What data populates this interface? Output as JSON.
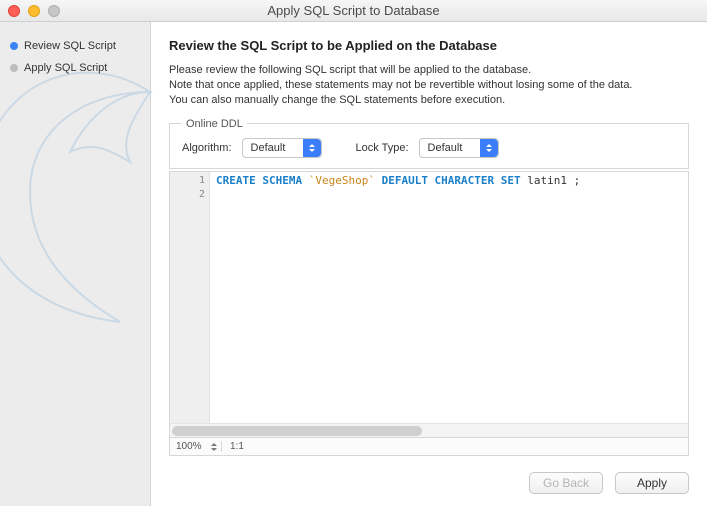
{
  "window": {
    "title": "Apply SQL Script to Database"
  },
  "steps": {
    "review": "Review SQL Script",
    "apply": "Apply SQL Script"
  },
  "heading": "Review the SQL Script to be Applied on the Database",
  "intro": {
    "l1": "Please review the following SQL script that will be applied to the database.",
    "l2": "Note that once applied, these statements may not be revertible without losing some of the data.",
    "l3": "You can also manually change the SQL statements before execution."
  },
  "ddl": {
    "legend": "Online DDL",
    "algo_label": "Algorithm:",
    "algo_value": "Default",
    "lock_label": "Lock Type:",
    "lock_value": "Default"
  },
  "code": {
    "line1_kw1": "CREATE SCHEMA",
    "line1_str": "`VegeShop`",
    "line1_kw2": "DEFAULT CHARACTER SET",
    "line1_tail": "latin1 ;",
    "lineno1": "1",
    "lineno2": "2"
  },
  "status": {
    "zoom": "100%",
    "ratio": "1:1"
  },
  "buttons": {
    "back": "Go Back",
    "apply": "Apply"
  }
}
